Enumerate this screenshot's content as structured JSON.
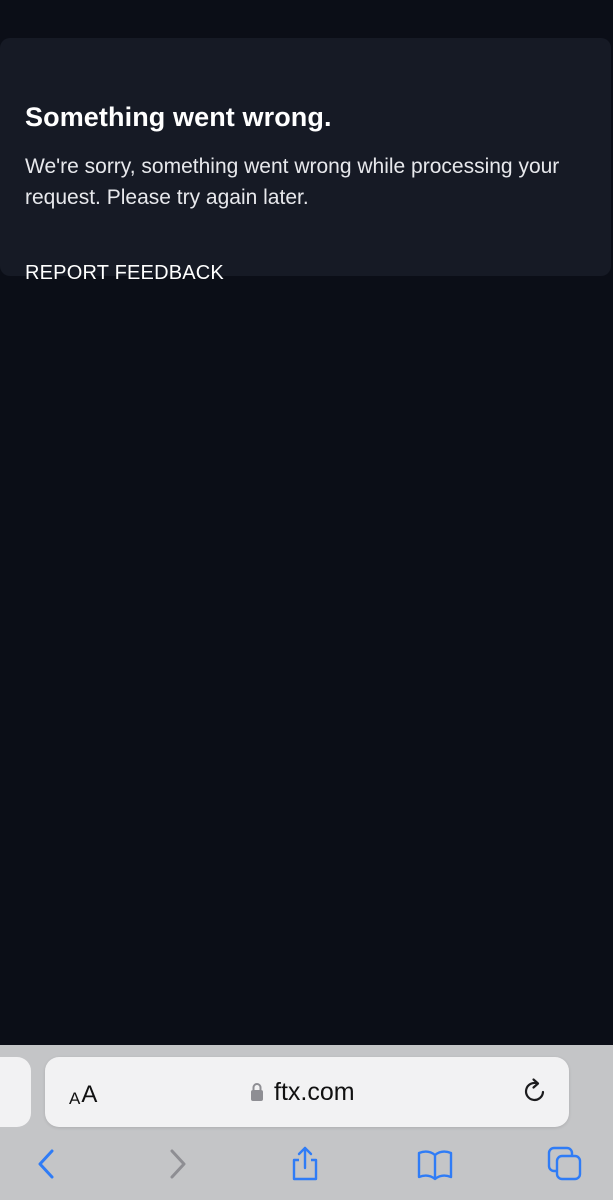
{
  "error": {
    "title": "Something went wrong.",
    "message": "We're sorry, something went wrong while processing your request. Please try again later.",
    "report_label": "REPORT FEEDBACK"
  },
  "browser": {
    "reader_small": "A",
    "reader_large": "A",
    "url": "ftx.com",
    "icons": [
      "lock-icon",
      "reload-icon",
      "back-icon",
      "forward-icon",
      "share-icon",
      "bookmarks-icon",
      "tabs-icon"
    ]
  },
  "colors": {
    "background": "#0b0e17",
    "card": "#161a25",
    "browser_chrome": "#c4c5c7",
    "address_bar": "#f2f2f3",
    "toolbar_accent": "#2f7cf6",
    "toolbar_disabled": "#8e8e93"
  }
}
